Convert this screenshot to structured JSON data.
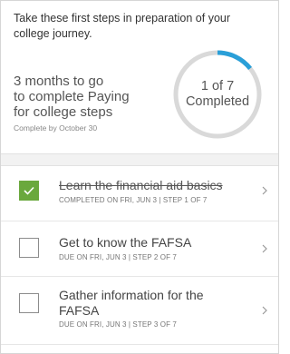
{
  "intro": {
    "text": "Take these first steps in preparation of your college journey."
  },
  "progress": {
    "headline_line1": "3 months to go",
    "headline_line2": "to complete Paying",
    "headline_line3": "for college steps",
    "due": "Complete by October 30",
    "ring_line1": "1 of 7",
    "ring_line2": "Completed",
    "completed_fraction": 0.143,
    "ring_color": "#2a9fd8",
    "track_color": "#d9d9d9"
  },
  "steps": [
    {
      "title": "Learn the financial aid basics",
      "meta": "COMPLETED ON FRI, JUN 3 | STEP 1 OF 7",
      "checked": true
    },
    {
      "title": "Get to know the FAFSA",
      "meta": "DUE ON FRI, JUN 3 | STEP 2 OF 7",
      "checked": false
    },
    {
      "title_line1": "Gather information for the",
      "title_line2": "FAFSA",
      "meta": "DUE ON FRI, JUN 3 | STEP 3 OF 7",
      "checked": false
    }
  ],
  "icons": {
    "check": "checkmark-icon",
    "chevron": "chevron-right-icon"
  },
  "colors": {
    "check_green": "#6aa83d",
    "accent_blue": "#2a9fd8"
  }
}
